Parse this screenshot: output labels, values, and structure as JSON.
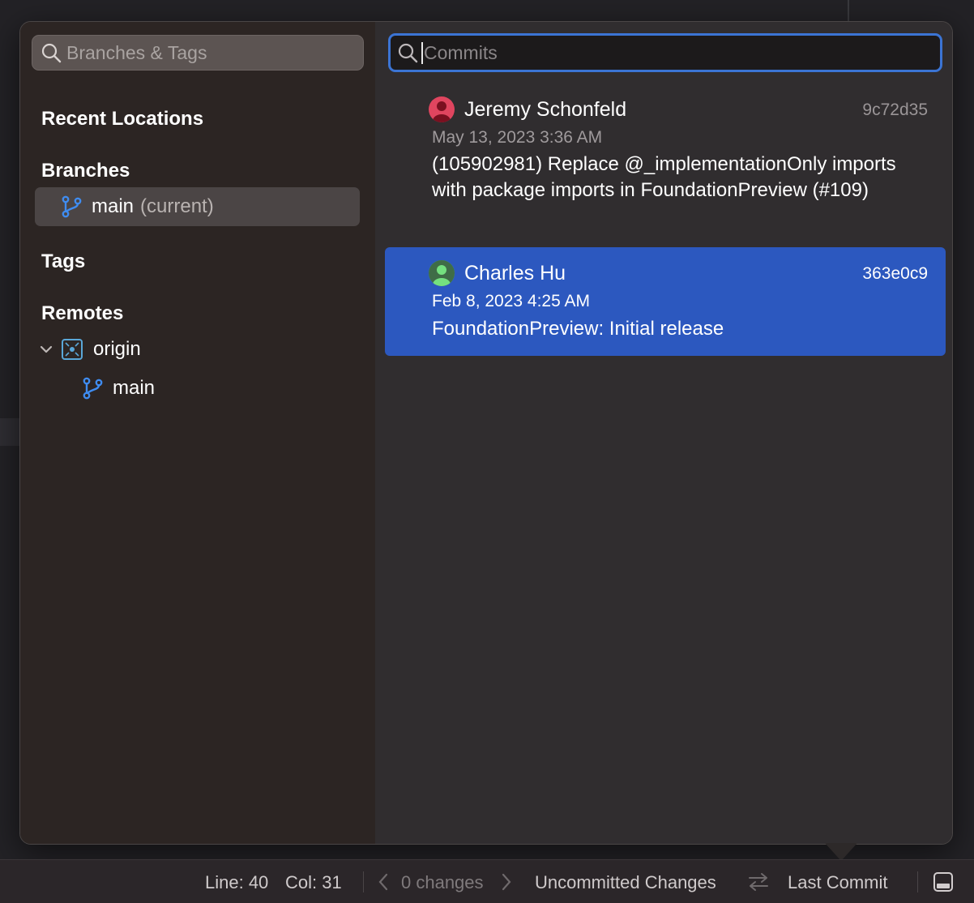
{
  "branches_search": {
    "placeholder": "Branches & Tags"
  },
  "commits_search": {
    "placeholder": "Commits"
  },
  "sidebar": {
    "recent_locations_title": "Recent Locations",
    "branches_title": "Branches",
    "branches": [
      {
        "name": "main",
        "note": "(current)"
      }
    ],
    "tags_title": "Tags",
    "remotes_title": "Remotes",
    "remotes": [
      {
        "name": "origin",
        "branches": [
          {
            "name": "main"
          }
        ]
      }
    ]
  },
  "commits": [
    {
      "author": "Jeremy Schonfeld",
      "hash": "9c72d35",
      "date": "May 13, 2023 3:36 AM",
      "message": "(105902981) Replace @_implementationOnly imports with package imports in FoundationPreview (#109)",
      "avatar_color": "#e0455f"
    },
    {
      "author": "Charles Hu",
      "hash": "363e0c9",
      "date": "Feb 8, 2023 4:25 AM",
      "message": "FoundationPreview: Initial release",
      "avatar_color": "#5fd36a"
    }
  ],
  "statusbar": {
    "line": "Line: 40",
    "col": "Col: 31",
    "changes": "0 changes",
    "uncommitted": "Uncommitted Changes",
    "last_commit": "Last Commit"
  },
  "colors": {
    "accent": "#2c58bf",
    "branch_icon": "#3f8cf0"
  }
}
